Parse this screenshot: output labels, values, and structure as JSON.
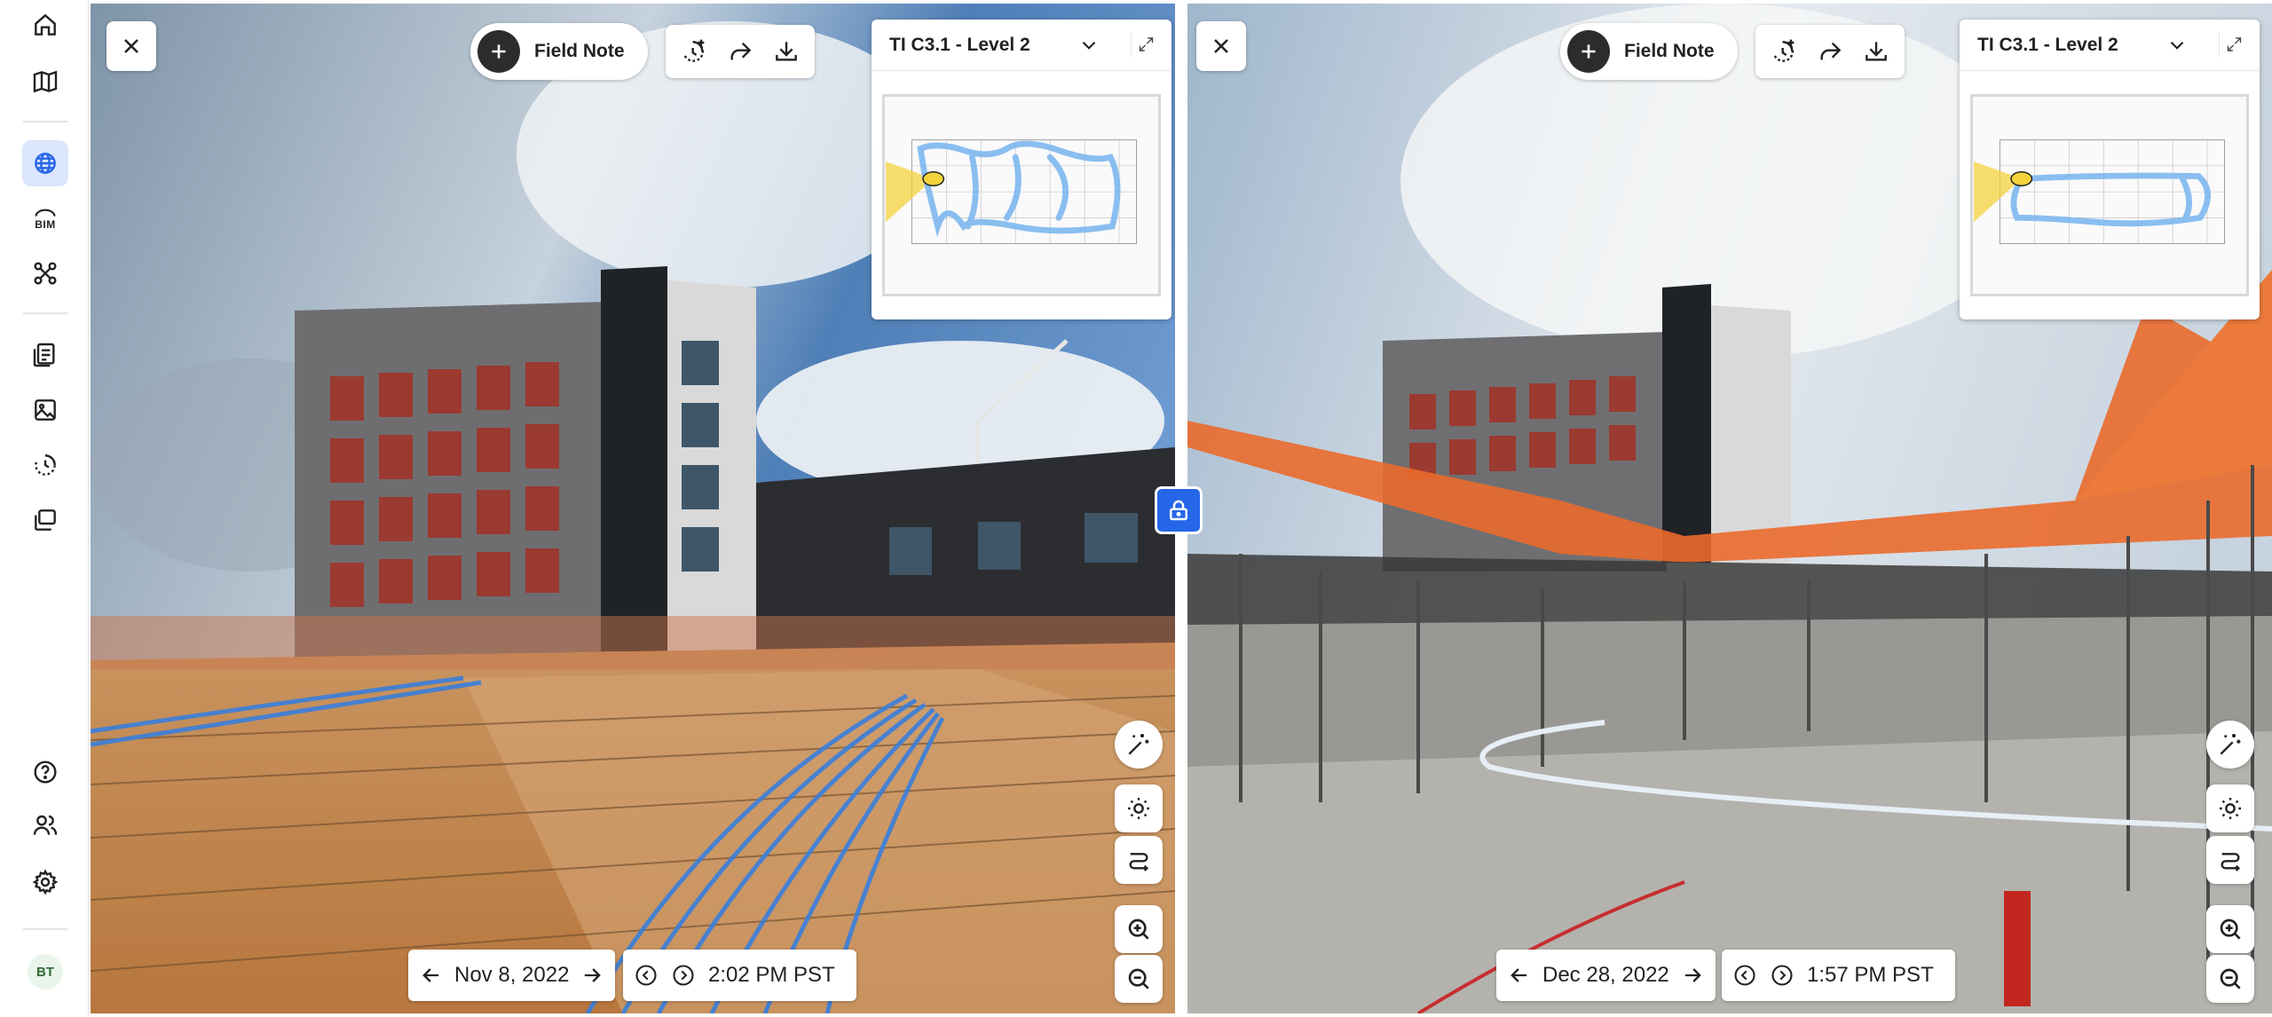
{
  "sidebar": {
    "items": [
      {
        "icon": "home-icon"
      },
      {
        "icon": "map-icon"
      },
      {
        "icon": "globe-icon",
        "active": true
      },
      {
        "icon": "bim-icon",
        "label": "BIM"
      },
      {
        "icon": "drone-icon"
      },
      {
        "icon": "report-icon"
      },
      {
        "icon": "image-icon"
      },
      {
        "icon": "timelapse-icon"
      },
      {
        "icon": "layers-icon"
      }
    ],
    "bottom": [
      {
        "icon": "help-icon"
      },
      {
        "icon": "users-icon"
      },
      {
        "icon": "settings-icon"
      }
    ],
    "avatar": "BT"
  },
  "left": {
    "field_note": "Field Note",
    "minimap_title": "TI C3.1 - Level 2",
    "date": "Nov 8, 2022",
    "time": "2:02 PM PST"
  },
  "right": {
    "field_note": "Field Note",
    "minimap_title": "TI C3.1 - Level 2",
    "date": "Dec 28, 2022",
    "time": "1:57 PM PST"
  },
  "colors": {
    "accent": "#2666e8",
    "active_bg": "#dbe5fb",
    "path": "#7db7ee",
    "viewcone": "#f4d23b"
  }
}
